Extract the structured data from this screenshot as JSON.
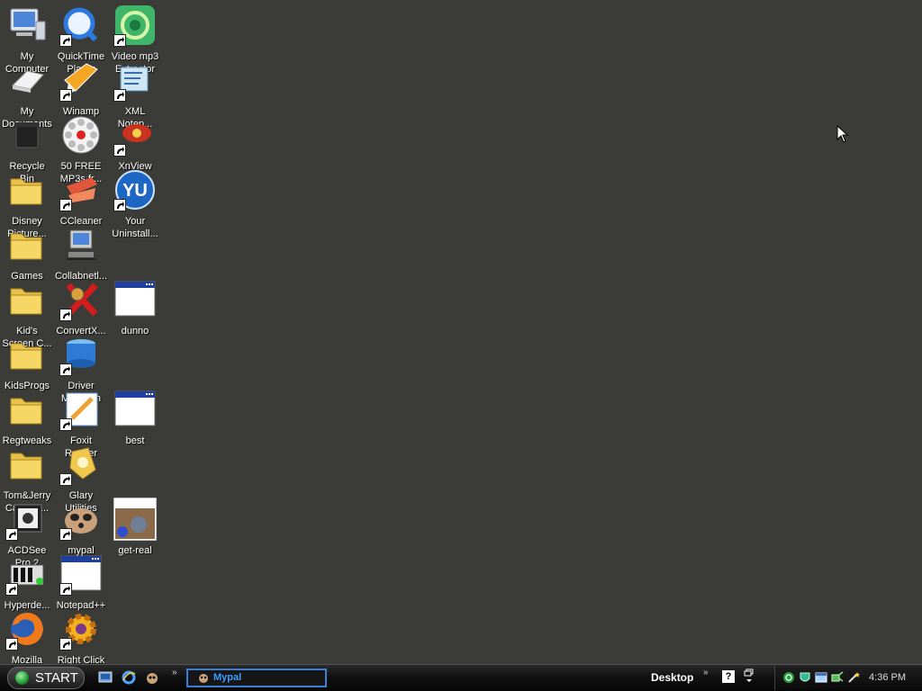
{
  "desktop": {
    "icons": [
      {
        "label": "My\nComputer",
        "icon": "my-computer-icon",
        "shortcut": false
      },
      {
        "label": "My\nDocuments",
        "icon": "my-documents-icon",
        "shortcut": false
      },
      {
        "label": "Recycle\nBin",
        "icon": "recycle-bin-icon",
        "shortcut": false
      },
      {
        "label": "Disney\nPicture...",
        "icon": "folder-icon",
        "shortcut": false
      },
      {
        "label": "Games",
        "icon": "folder-icon",
        "shortcut": false
      },
      {
        "label": "Kid's\nScreen C...",
        "icon": "folder-icon",
        "shortcut": false
      },
      {
        "label": "KidsProgs",
        "icon": "folder-icon",
        "shortcut": false
      },
      {
        "label": "Regtweaks",
        "icon": "folder-icon",
        "shortcut": false
      },
      {
        "label": "Tom&Jerry\nCartoon...",
        "icon": "folder-icon",
        "shortcut": false
      },
      {
        "label": "ACDSee\nPro 2",
        "icon": "acdsee-icon",
        "shortcut": true
      },
      {
        "label": "Hyperde...",
        "icon": "hyperdesk-icon",
        "shortcut": true
      },
      {
        "label": "Mozilla",
        "icon": "firefox-icon",
        "shortcut": true
      },
      {
        "label": "QuickTime\nPlayer",
        "icon": "quicktime-icon",
        "shortcut": true
      },
      {
        "label": "Winamp",
        "icon": "winamp-icon",
        "shortcut": true
      },
      {
        "label": "50 FREE\nMP3s fr...",
        "icon": "mp3-icon",
        "shortcut": false
      },
      {
        "label": "CCleaner",
        "icon": "ccleaner-icon",
        "shortcut": true
      },
      {
        "label": "Collabnetl...",
        "icon": "network-computer-icon",
        "shortcut": false
      },
      {
        "label": "ConvertX...\n3",
        "icon": "convertx-icon",
        "shortcut": true
      },
      {
        "label": "Driver\nMagician",
        "icon": "driver-magician-icon",
        "shortcut": true
      },
      {
        "label": "Foxit\nReader",
        "icon": "foxit-reader-icon",
        "shortcut": true
      },
      {
        "label": "Glary\nUtilities",
        "icon": "glary-utilities-icon",
        "shortcut": true
      },
      {
        "label": "mypal",
        "icon": "mypal-icon",
        "shortcut": true
      },
      {
        "label": "Notepad++",
        "icon": "window-icon",
        "shortcut": true
      },
      {
        "label": "Right Click",
        "icon": "gear-icon",
        "shortcut": true
      },
      {
        "label": "Video mp3\nExtractor",
        "icon": "video-mp3-icon",
        "shortcut": true
      },
      {
        "label": "XML\nNotep...",
        "icon": "xml-notepad-icon",
        "shortcut": true
      },
      {
        "label": "XnView",
        "icon": "xnview-icon",
        "shortcut": true
      },
      {
        "label": "Your\nUninstall...",
        "icon": "uninstaller-icon",
        "shortcut": true
      },
      {
        "label": "dunno",
        "icon": "window-icon",
        "shortcut": false
      },
      {
        "label": "best",
        "icon": "window-icon",
        "shortcut": false
      },
      {
        "label": "get-real",
        "icon": "image-thumbnail-icon",
        "shortcut": false
      }
    ]
  },
  "taskbar": {
    "start_label": "START",
    "quick_launch": [
      "show-desktop-icon",
      "internet-explorer-icon",
      "mypal-icon"
    ],
    "chevron": "»",
    "task_button_label": "Mypal",
    "toolbar_label": "Desktop",
    "help": "?",
    "tray_icons": [
      "network-icon",
      "antivirus-icon",
      "window-icon",
      "connection-icon",
      "wand-icon"
    ],
    "clock": "4:36 PM"
  },
  "colors": {
    "desktop_background": "#3b3b37",
    "task_highlight": "#3c7fd6"
  }
}
